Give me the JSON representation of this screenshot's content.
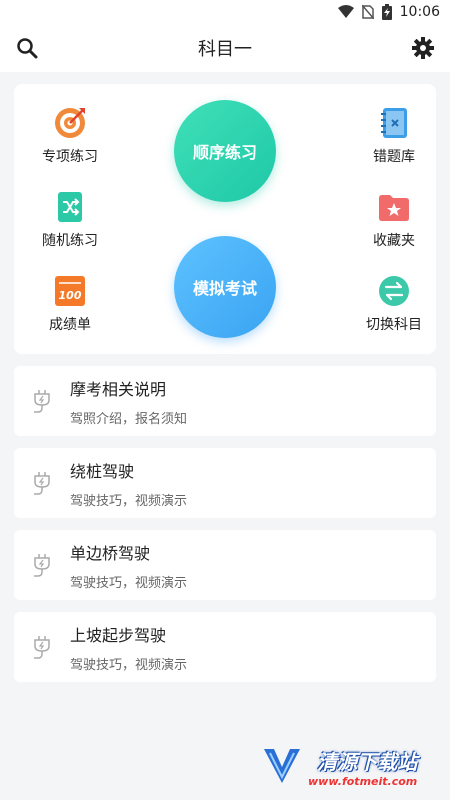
{
  "status_bar": {
    "time": "10:06"
  },
  "header": {
    "title": "科目一"
  },
  "features": {
    "special_practice": "专项练习",
    "wrong_questions": "错题库",
    "random_practice": "随机练习",
    "favorites": "收藏夹",
    "scores": "成绩单",
    "switch_subject": "切换科目",
    "sequential_practice": "顺序练习",
    "mock_exam": "模拟考试"
  },
  "list": [
    {
      "title": "摩考相关说明",
      "subtitle": "驾照介绍，报名须知"
    },
    {
      "title": "绕桩驾驶",
      "subtitle": "驾驶技巧，视频演示"
    },
    {
      "title": "单边桥驾驶",
      "subtitle": "驾驶技巧，视频演示"
    },
    {
      "title": "上坡起步驾驶",
      "subtitle": "驾驶技巧，视频演示"
    }
  ],
  "watermark": {
    "main": "清源下载站",
    "url": "www.fotmeit.com"
  },
  "colors": {
    "accent_green": "#1fc8a8",
    "accent_blue": "#3aa4f2"
  }
}
